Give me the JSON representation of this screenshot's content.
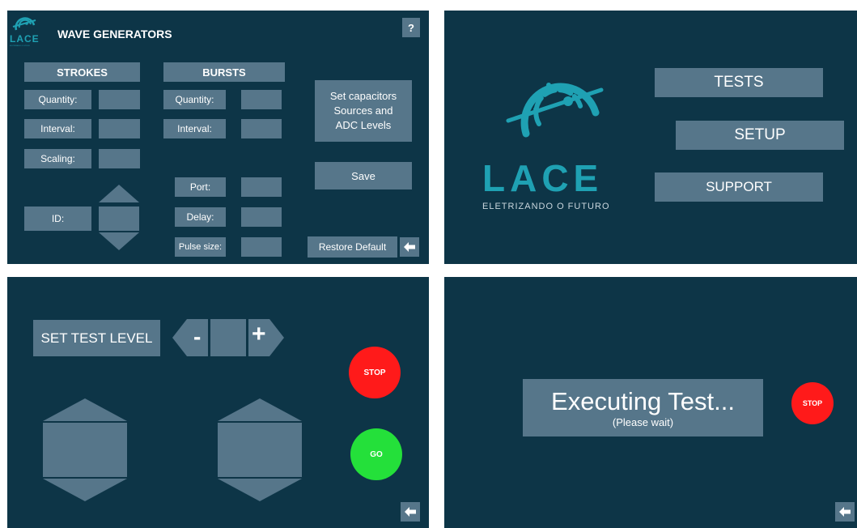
{
  "colors": {
    "panel_bg": "#0d3547",
    "control": "#56768a",
    "logo_accent": "#1fa1b3",
    "stop": "#ff1a1a",
    "go": "#24e03a"
  },
  "wave_generators": {
    "logo_text": "LACE",
    "logo_tagline": "ELETRIZANDO O FUTURO",
    "title": "WAVE GENERATORS",
    "help_label": "?",
    "strokes": {
      "header": "STROKES",
      "quantity_label": "Quantity:",
      "interval_label": "Interval:",
      "scaling_label": "Scaling:",
      "id_label": "ID:"
    },
    "bursts": {
      "header": "BURSTS",
      "quantity_label": "Quantity:",
      "interval_label": "Interval:",
      "port_label": "Port:",
      "delay_label": "Delay:",
      "pulse_size_label": "Pulse size:"
    },
    "set_capacitors_label": "Set capacitors Sources and ADC Levels",
    "save_label": "Save",
    "restore_default_label": "Restore Default",
    "back_icon": "back-arrow-icon"
  },
  "main_menu": {
    "logo_text": "LACE",
    "logo_tagline": "ELETRIZANDO O FUTURO",
    "tests_label": "TESTS",
    "setup_label": "SETUP",
    "support_label": "SUPPORT"
  },
  "test_level": {
    "set_test_level_label": "SET TEST LEVEL",
    "minus_label": "-",
    "plus_label": "+",
    "stop_label": "STOP",
    "go_label": "GO",
    "back_icon": "back-arrow-icon"
  },
  "executing": {
    "status_title": "Executing Test...",
    "status_subtitle": "(Please wait)",
    "stop_label": "STOP",
    "back_icon": "back-arrow-icon"
  }
}
